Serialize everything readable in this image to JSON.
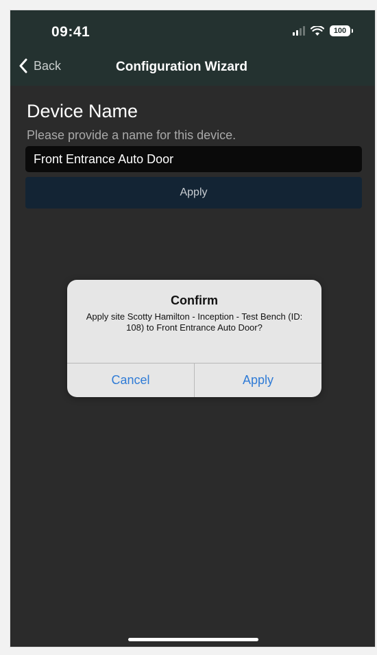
{
  "status_bar": {
    "time": "09:41",
    "battery": "100"
  },
  "nav": {
    "back_label": "Back",
    "title": "Configuration Wizard"
  },
  "main": {
    "heading": "Device Name",
    "subtitle": "Please provide a name for this device.",
    "name_value": "Front Entrance Auto Door",
    "apply_label": "Apply"
  },
  "dialog": {
    "title": "Confirm",
    "message": "Apply site Scotty Hamilton - Inception - Test Bench (ID: 108) to Front Entrance Auto Door?",
    "cancel_label": "Cancel",
    "apply_label": "Apply"
  },
  "colors": {
    "header_bg": "#243230",
    "screen_bg": "#2b2b2b",
    "link_blue": "#2f7bd6"
  },
  "icons": {
    "back": "chevron-left-icon",
    "signal": "cellular-signal-icon",
    "wifi": "wifi-icon",
    "battery": "battery-icon"
  }
}
